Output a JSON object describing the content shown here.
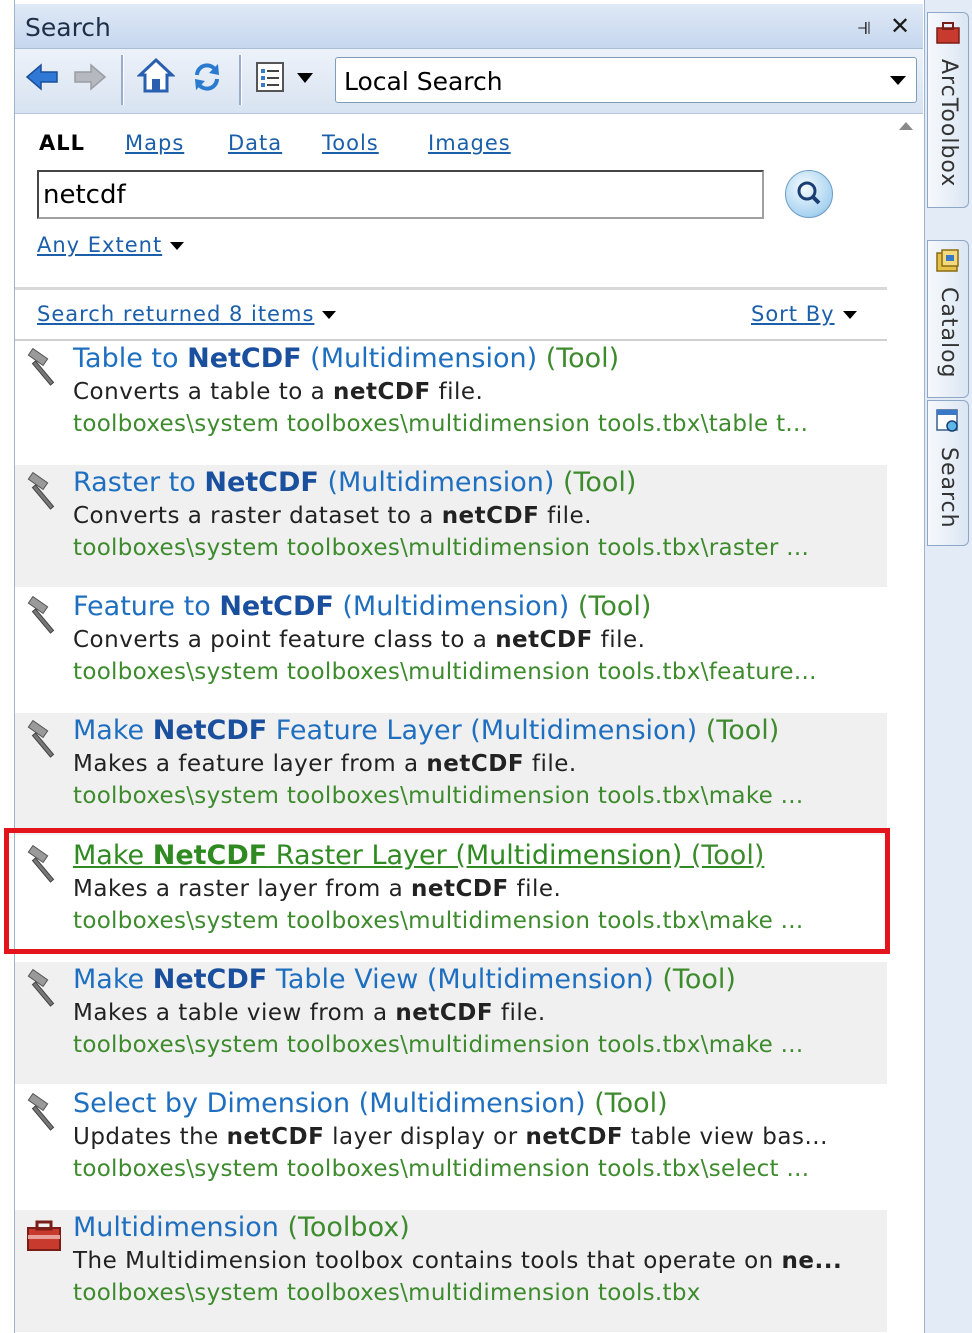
{
  "window": {
    "title": "Search"
  },
  "toolbar": {
    "scope_combo_value": "Local Search"
  },
  "filters": {
    "tabs": [
      {
        "label": "ALL",
        "active": true
      },
      {
        "label": "Maps",
        "active": false
      },
      {
        "label": "Data",
        "active": false
      },
      {
        "label": "Tools",
        "active": false
      },
      {
        "label": "Images",
        "active": false
      }
    ]
  },
  "search": {
    "query": "netcdf",
    "extent_label": "Any Extent"
  },
  "results_header": {
    "count_label": "Search returned 8 items",
    "sort_label": "Sort By"
  },
  "results": [
    {
      "title_pre": "Table to ",
      "title_bold": "NetCDF",
      "title_post": " (Multidimension)",
      "kind": " (Tool)",
      "desc_pre": "Converts a table to a ",
      "desc_bold": "netCDF",
      "desc_post": " file.",
      "path": "toolboxes\\system toolboxes\\multidimension tools.tbx\\table t...",
      "icon": "hammer-icon"
    },
    {
      "title_pre": "Raster to ",
      "title_bold": "NetCDF",
      "title_post": " (Multidimension)",
      "kind": " (Tool)",
      "desc_pre": "Converts a raster dataset to a ",
      "desc_bold": "netCDF",
      "desc_post": " file.",
      "path": "toolboxes\\system toolboxes\\multidimension tools.tbx\\raster ...",
      "icon": "hammer-icon"
    },
    {
      "title_pre": "Feature to ",
      "title_bold": "NetCDF",
      "title_post": " (Multidimension)",
      "kind": " (Tool)",
      "desc_pre": "Converts a point feature class to a ",
      "desc_bold": "netCDF",
      "desc_post": " file.",
      "path": "toolboxes\\system toolboxes\\multidimension tools.tbx\\feature...",
      "icon": "hammer-icon"
    },
    {
      "title_pre": "Make ",
      "title_bold": "NetCDF",
      "title_post": " Feature Layer (Multidimension)",
      "kind": " (Tool)",
      "desc_pre": "Makes a feature layer from a ",
      "desc_bold": "netCDF",
      "desc_post": " file.",
      "path": "toolboxes\\system toolboxes\\multidimension tools.tbx\\make ...",
      "icon": "hammer-icon"
    },
    {
      "title_pre": "Make ",
      "title_bold": "NetCDF",
      "title_post": " Raster Layer (Multidimension) ",
      "kind": "(Tool)",
      "desc_pre": "Makes a raster layer from a ",
      "desc_bold": "netCDF",
      "desc_post": " file.",
      "path": "toolboxes\\system toolboxes\\multidimension tools.tbx\\make ...",
      "icon": "hammer-icon",
      "selected": true
    },
    {
      "title_pre": "Make ",
      "title_bold": "NetCDF",
      "title_post": " Table View (Multidimension)",
      "kind": " (Tool)",
      "desc_pre": "Makes a table view from a ",
      "desc_bold": "netCDF",
      "desc_post": " file.",
      "path": "toolboxes\\system toolboxes\\multidimension tools.tbx\\make ...",
      "icon": "hammer-icon"
    },
    {
      "title_pre": "Select by Dimension (Multidimension)",
      "title_bold": "",
      "title_post": "",
      "kind": " (Tool)",
      "desc_pre": "Updates the ",
      "desc_bold": "netCDF",
      "desc_post": " layer display or ",
      "desc_bold2": "netCDF",
      "desc_post2": " table view bas...",
      "path": "toolboxes\\system toolboxes\\multidimension tools.tbx\\select ...",
      "icon": "hammer-icon"
    },
    {
      "title_pre": "Multidimension",
      "title_bold": "",
      "title_post": "",
      "kind": " (Toolbox)",
      "desc_pre": "The Multidimension toolbox contains tools that operate on ",
      "desc_bold": "ne...",
      "desc_post": "",
      "path": "toolboxes\\system toolboxes\\multidimension tools.tbx",
      "icon": "toolbox-icon"
    }
  ],
  "side_tabs": [
    {
      "label": "ArcToolbox",
      "icon": "toolbox-icon"
    },
    {
      "label": "Catalog",
      "icon": "catalog-icon"
    },
    {
      "label": "Search",
      "icon": "search-window-icon"
    }
  ]
}
